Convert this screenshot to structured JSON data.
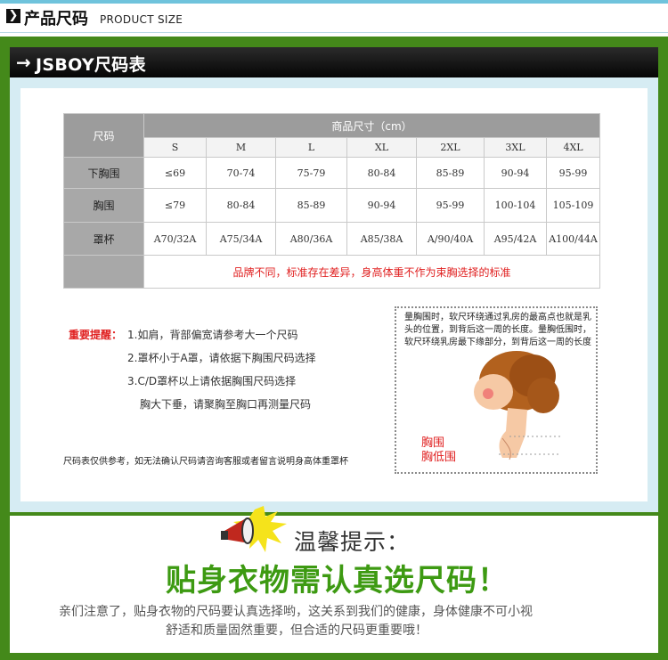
{
  "header": {
    "icon_glyph": "❯",
    "title": "产品尺码",
    "subtitle": "PRODUCT SIZE"
  },
  "bar": {
    "arrow": "→",
    "title": "JSBOY尺码表"
  },
  "table": {
    "corner_label": "尺码",
    "group_header": "商品尺寸（cm）",
    "sizes": [
      "S",
      "M",
      "L",
      "XL",
      "2XL",
      "3XL",
      "4XL"
    ],
    "rows": [
      {
        "label": "下胸围",
        "values": [
          "≤69",
          "70-74",
          "75-79",
          "80-84",
          "85-89",
          "90-94",
          "95-99"
        ]
      },
      {
        "label": "胸围",
        "values": [
          "≤79",
          "80-84",
          "85-89",
          "90-94",
          "95-99",
          "100-104",
          "105-109"
        ]
      },
      {
        "label": "罩杯",
        "values": [
          "A70/32A",
          "A75/34A",
          "A80/36A",
          "A85/38A",
          "A/90/40A",
          "A95/42A",
          "A100/44A"
        ]
      }
    ],
    "note": "品牌不同，标准存在差异，身高体重不作为束胸选择的标准"
  },
  "reminder": {
    "label": "重要提醒：",
    "lines": [
      "1.如肩，背部偏宽请参考大一个尺码",
      "2.罩杯小于A罩，请依据下胸围尺码选择",
      "3.C/D罩杯以上请依据胸围尺码选择",
      "胸大下垂，请聚胸至胸口再测量尺码"
    ],
    "footnote": "尺码表仅供参考，如无法确认尺码请咨询客服或者留言说明身高体重罩杯"
  },
  "figure": {
    "text": "量胸围时，软尺环绕通过乳房的最高点也就是乳头的位置，到背后这一周的长度。量胸低围时，软尺环绕乳房最下缘部分，到背后这一周的长度",
    "chest_label": "胸围",
    "under_label": "胸低围"
  },
  "tip": {
    "title": "温馨提示：",
    "headline": "贴身衣物需认真选尺码！",
    "line1": "亲们注意了，贴身衣物的尺码要认真选择哟，这关系到我们的健康，身体健康不可小视",
    "line2": "舒适和质量固然重要，但合适的尺码更重要哦！"
  },
  "colors": {
    "frame_green": "#44891a",
    "headline_green": "#3d9a12",
    "alert_red": "#e02020",
    "panel_blue": "#d6ecf3"
  }
}
